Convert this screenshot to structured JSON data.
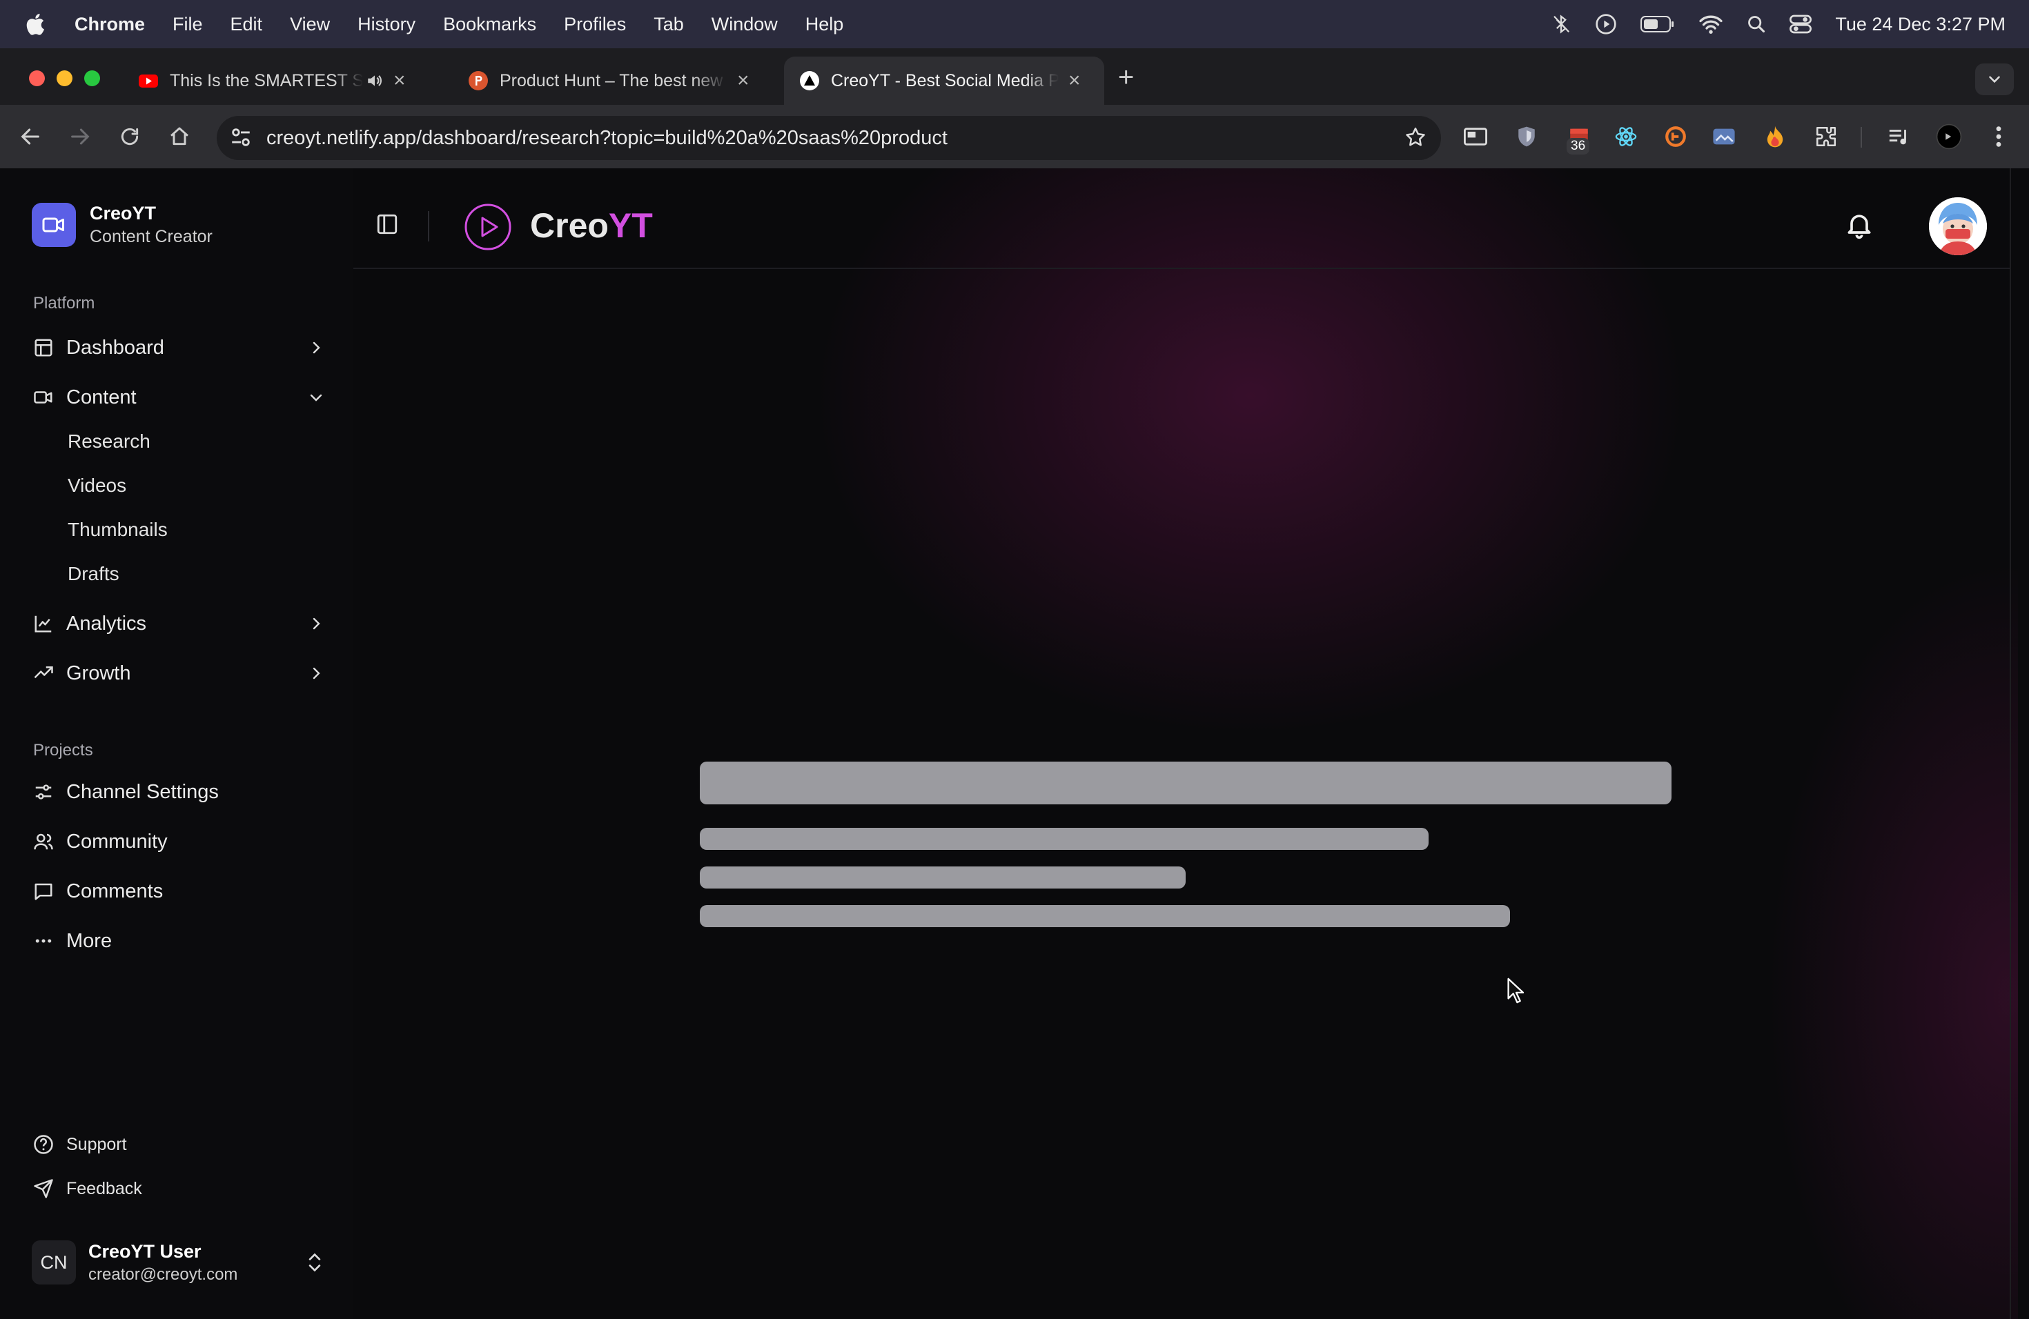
{
  "menubar": {
    "app": "Chrome",
    "items": [
      "File",
      "Edit",
      "View",
      "History",
      "Bookmarks",
      "Profiles",
      "Tab",
      "Window",
      "Help"
    ],
    "clock": "Tue 24 Dec  3:27 PM"
  },
  "tabs": [
    {
      "title": "This Is the SMARTEST Sa",
      "favicon": "youtube-icon"
    },
    {
      "title": "Product Hunt – The best new",
      "favicon": "product-hunt-icon"
    },
    {
      "title": "CreoYT - Best Social Media P",
      "favicon": "creoyt-icon"
    }
  ],
  "omnibox": {
    "url": "creoyt.netlify.app/dashboard/research?topic=build%20a%20saas%20product"
  },
  "extensions": {
    "badge": "36"
  },
  "sidebar": {
    "brand_name": "CreoYT",
    "brand_sub": "Content Creator",
    "platform_label": "Platform",
    "nav": {
      "dashboard": "Dashboard",
      "content": "Content",
      "research": "Research",
      "videos": "Videos",
      "thumbnails": "Thumbnails",
      "drafts": "Drafts",
      "analytics": "Analytics",
      "growth": "Growth"
    },
    "projects_label": "Projects",
    "projects": {
      "channel_settings": "Channel Settings",
      "community": "Community",
      "comments": "Comments",
      "more": "More"
    },
    "support": "Support",
    "feedback": "Feedback",
    "user": {
      "initials": "CN",
      "name": "CreoYT User",
      "email": "creator@creoyt.com"
    }
  },
  "header": {
    "logo_part1": "Creo",
    "logo_part2": "YT"
  },
  "colors": {
    "accent": "#d24fe0",
    "brand_logo_bg": "#5b5fe6",
    "skeleton": "#9b9ba0"
  }
}
